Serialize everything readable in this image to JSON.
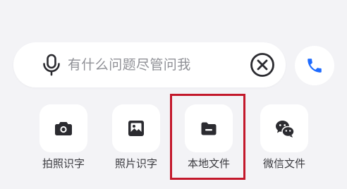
{
  "input": {
    "placeholder": "有什么问题尽管问我",
    "mic_icon": "microphone-icon",
    "clear_icon": "circle-x-clear-icon"
  },
  "call": {
    "icon": "phone-icon",
    "color": "#1e6bff"
  },
  "tools": [
    {
      "label": "拍照识字",
      "icon": "camera-icon"
    },
    {
      "label": "照片识字",
      "icon": "image-icon"
    },
    {
      "label": "本地文件",
      "icon": "folder-icon"
    },
    {
      "label": "微信文件",
      "icon": "wechat-icon"
    }
  ],
  "colors": {
    "background": "#f3f3f6",
    "card": "#ffffff",
    "icon": "#2b2b30",
    "highlight": "#c3182b"
  }
}
